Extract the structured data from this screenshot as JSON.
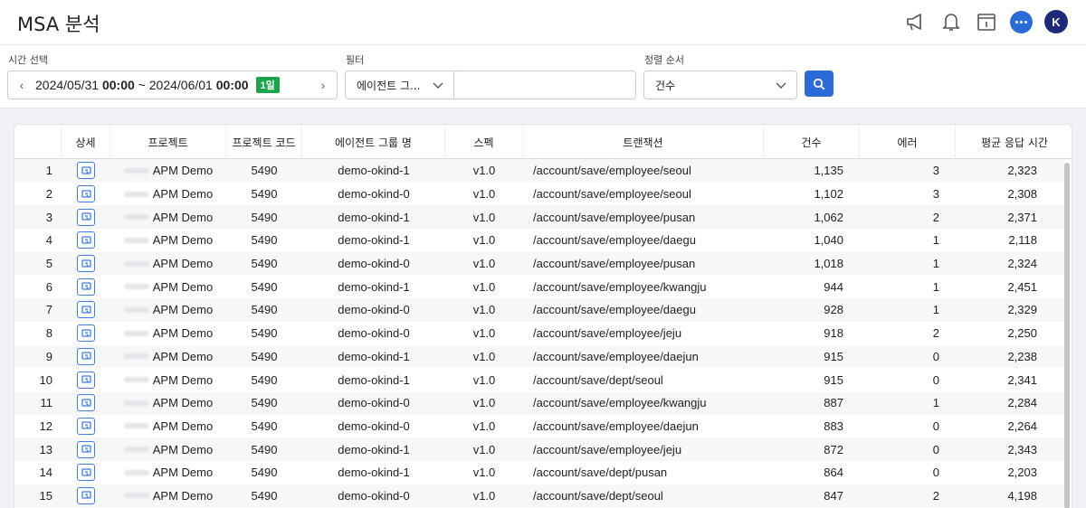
{
  "header": {
    "title": "MSA 분석"
  },
  "user": {
    "initial": "K"
  },
  "filters": {
    "time_label": "시간 선택",
    "time_start_date": "2024/05/31",
    "time_start_hm": "00:00",
    "time_sep": "~",
    "time_end_date": "2024/06/01",
    "time_end_hm": "00:00",
    "range_badge": "1일",
    "filter_label": "필터",
    "filter_type": "에이전트 그...",
    "filter_value": "",
    "sort_label": "정렬 순서",
    "sort_value": "건수"
  },
  "table": {
    "columns": [
      "",
      "상세",
      "프로젝트",
      "프로젝트 코드",
      "에이전트 그룹 명",
      "스펙",
      "트랜잭션",
      "건수",
      "에러",
      "평균 응답 시간"
    ],
    "rows": [
      {
        "no": "1",
        "project": "APM Demo",
        "code": "5490",
        "group": "demo-okind-1",
        "spec": "v1.0",
        "tx": "/account/save/employee/seoul",
        "count": "1,135",
        "error": "3",
        "avg": "2,323"
      },
      {
        "no": "2",
        "project": "APM Demo",
        "code": "5490",
        "group": "demo-okind-0",
        "spec": "v1.0",
        "tx": "/account/save/employee/seoul",
        "count": "1,102",
        "error": "3",
        "avg": "2,308"
      },
      {
        "no": "3",
        "project": "APM Demo",
        "code": "5490",
        "group": "demo-okind-1",
        "spec": "v1.0",
        "tx": "/account/save/employee/pusan",
        "count": "1,062",
        "error": "2",
        "avg": "2,371"
      },
      {
        "no": "4",
        "project": "APM Demo",
        "code": "5490",
        "group": "demo-okind-1",
        "spec": "v1.0",
        "tx": "/account/save/employee/daegu",
        "count": "1,040",
        "error": "1",
        "avg": "2,118"
      },
      {
        "no": "5",
        "project": "APM Demo",
        "code": "5490",
        "group": "demo-okind-0",
        "spec": "v1.0",
        "tx": "/account/save/employee/pusan",
        "count": "1,018",
        "error": "1",
        "avg": "2,324"
      },
      {
        "no": "6",
        "project": "APM Demo",
        "code": "5490",
        "group": "demo-okind-1",
        "spec": "v1.0",
        "tx": "/account/save/employee/kwangju",
        "count": "944",
        "error": "1",
        "avg": "2,451"
      },
      {
        "no": "7",
        "project": "APM Demo",
        "code": "5490",
        "group": "demo-okind-0",
        "spec": "v1.0",
        "tx": "/account/save/employee/daegu",
        "count": "928",
        "error": "1",
        "avg": "2,329"
      },
      {
        "no": "8",
        "project": "APM Demo",
        "code": "5490",
        "group": "demo-okind-0",
        "spec": "v1.0",
        "tx": "/account/save/employee/jeju",
        "count": "918",
        "error": "2",
        "avg": "2,250"
      },
      {
        "no": "9",
        "project": "APM Demo",
        "code": "5490",
        "group": "demo-okind-1",
        "spec": "v1.0",
        "tx": "/account/save/employee/daejun",
        "count": "915",
        "error": "0",
        "avg": "2,238"
      },
      {
        "no": "10",
        "project": "APM Demo",
        "code": "5490",
        "group": "demo-okind-1",
        "spec": "v1.0",
        "tx": "/account/save/dept/seoul",
        "count": "915",
        "error": "0",
        "avg": "2,341"
      },
      {
        "no": "11",
        "project": "APM Demo",
        "code": "5490",
        "group": "demo-okind-0",
        "spec": "v1.0",
        "tx": "/account/save/employee/kwangju",
        "count": "887",
        "error": "1",
        "avg": "2,284"
      },
      {
        "no": "12",
        "project": "APM Demo",
        "code": "5490",
        "group": "demo-okind-0",
        "spec": "v1.0",
        "tx": "/account/save/employee/daejun",
        "count": "883",
        "error": "0",
        "avg": "2,264"
      },
      {
        "no": "13",
        "project": "APM Demo",
        "code": "5490",
        "group": "demo-okind-1",
        "spec": "v1.0",
        "tx": "/account/save/employee/jeju",
        "count": "872",
        "error": "0",
        "avg": "2,343"
      },
      {
        "no": "14",
        "project": "APM Demo",
        "code": "5490",
        "group": "demo-okind-1",
        "spec": "v1.0",
        "tx": "/account/save/dept/pusan",
        "count": "864",
        "error": "0",
        "avg": "2,203"
      },
      {
        "no": "15",
        "project": "APM Demo",
        "code": "5490",
        "group": "demo-okind-0",
        "spec": "v1.0",
        "tx": "/account/save/dept/seoul",
        "count": "847",
        "error": "2",
        "avg": "4,198"
      }
    ]
  },
  "colors": {
    "accent": "#2a6bd8",
    "badge": "#19a34a",
    "avatar": "#1e2a78"
  },
  "icons": [
    "megaphone-icon",
    "bell-icon",
    "calendar-icon",
    "chat-icon",
    "search-icon",
    "chevron-down-icon",
    "detail-icon"
  ]
}
